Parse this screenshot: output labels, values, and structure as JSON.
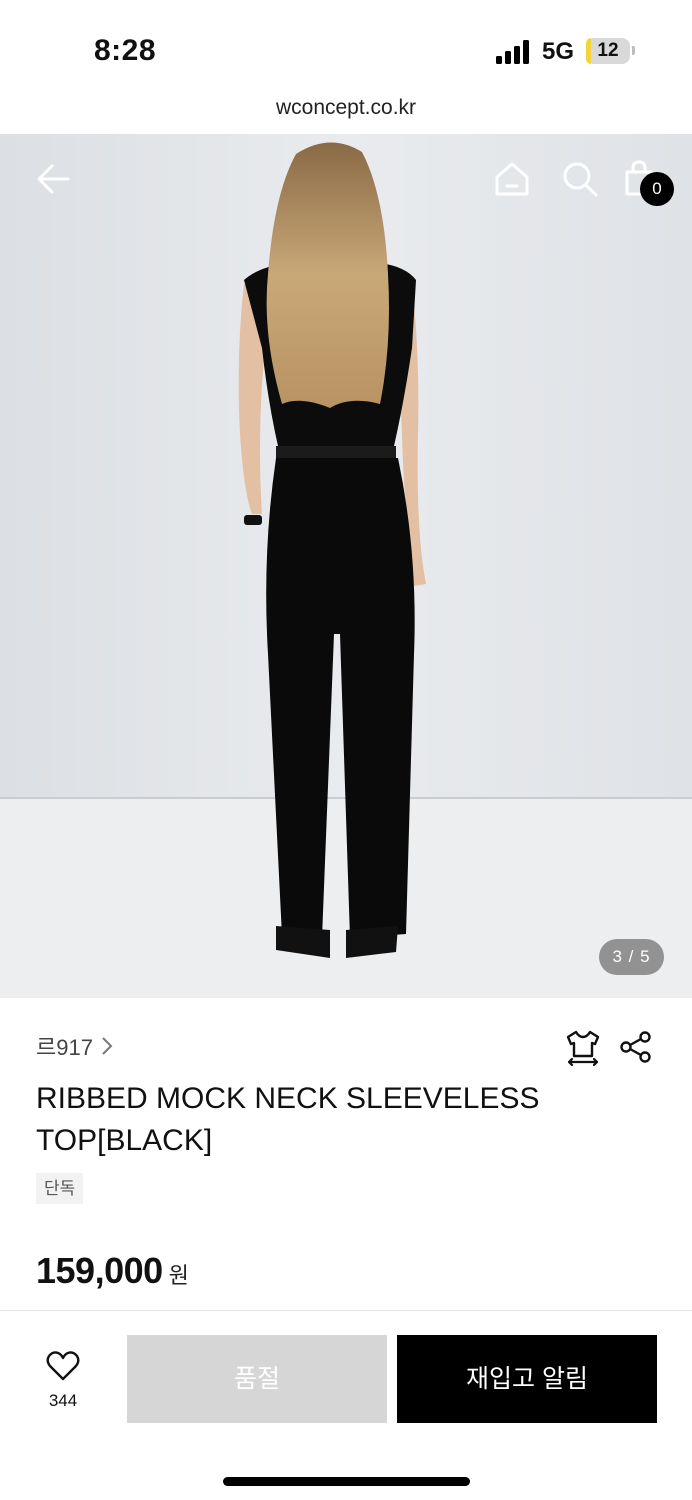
{
  "status_bar": {
    "time": "8:28",
    "network": "5G",
    "battery_level": "12",
    "battery_fraction": 0.12,
    "signal_icon": "cellular-signal-icon"
  },
  "browser": {
    "url": "wconcept.co.kr"
  },
  "top_nav": {
    "back_icon": "arrow-left-icon",
    "home_icon": "home-icon",
    "search_icon": "search-icon",
    "cart_icon": "shopping-bag-icon",
    "cart_count": "0"
  },
  "gallery": {
    "counter": "3 / 5",
    "current": 3,
    "total": 5
  },
  "product": {
    "brand": "르917",
    "title": "RIBBED MOCK NECK SLEEVELESS TOP[BLACK]",
    "tag": "단독",
    "price": "159,000",
    "currency": "원",
    "size_icon": "tshirt-size-icon",
    "share_icon": "share-icon"
  },
  "bottom_bar": {
    "like_icon": "heart-icon",
    "like_count": "344",
    "soldout_label": "품절",
    "restock_label": "재입고 알림"
  },
  "colors": {
    "accent": "#000000",
    "disabled_button": "#d6d6d6",
    "battery_low": "#f5d33c"
  }
}
